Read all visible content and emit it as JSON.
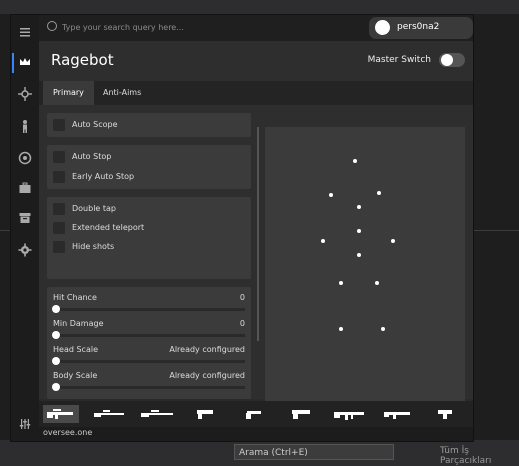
{
  "menu": {
    "search_placeholder": "Type your search query here...",
    "username": "pers0na2",
    "page_title": "Ragebot",
    "master_switch_label": "Master Switch",
    "tabs": [
      "Primary",
      "Anti-Aims"
    ],
    "footer": "oversee.one"
  },
  "checkboxes": {
    "auto_scope": "Auto Scope",
    "auto_stop": "Auto Stop",
    "early_auto_stop": "Early Auto Stop",
    "double_tap": "Double tap",
    "extended_teleport": "Extended teleport",
    "hide_shots": "Hide shots"
  },
  "sliders": [
    {
      "label": "Hit Chance",
      "value": "0"
    },
    {
      "label": "Min Damage",
      "value": "0"
    },
    {
      "label": "Head Scale",
      "value": "Already configured"
    },
    {
      "label": "Body Scale",
      "value": "Already configured"
    }
  ],
  "weapons": [
    "auto-sniper-icon",
    "scout-icon",
    "awp-icon",
    "pistol-icon",
    "revolver-icon",
    "deagle-icon",
    "rifle-icon",
    "smg-icon",
    "taser-icon"
  ],
  "ide": {
    "search": "Arama (Ctrl+E)",
    "tab": "Tüm İş Parçacıkları"
  }
}
